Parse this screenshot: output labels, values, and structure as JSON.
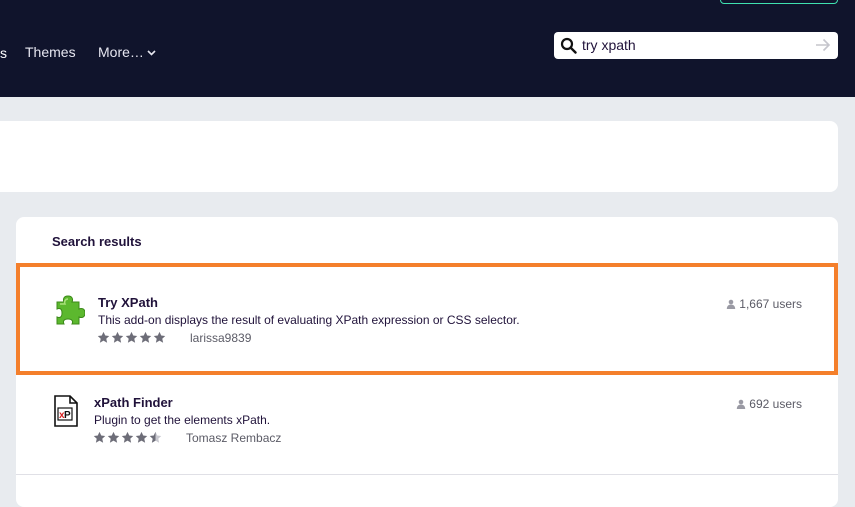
{
  "header": {
    "nav": {
      "themes": "Themes",
      "more": "More…"
    },
    "search": {
      "value": "try xpath"
    }
  },
  "results": {
    "title": "Search results",
    "items": [
      {
        "name": "Try XPath",
        "description": "This add-on displays the result of evaluating XPath expression or CSS selector.",
        "author": "larissa9839",
        "users": "1,667 users",
        "rating": 5,
        "icon": "puzzle-piece-icon",
        "highlighted": true
      },
      {
        "name": "xPath Finder",
        "description": "Plugin to get the elements xPath.",
        "author": "Tomasz Rembacz",
        "users": "692 users",
        "rating": 4.5,
        "icon": "xpath-document-icon",
        "highlighted": false
      }
    ]
  },
  "colors": {
    "header_bg": "#10142c",
    "highlight_border": "#f47f2b",
    "page_bg": "#e8ebef"
  }
}
